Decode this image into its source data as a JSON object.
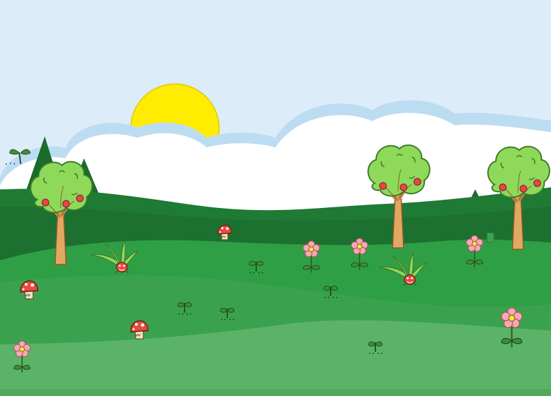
{
  "scene": {
    "type": "side-scrolling game background",
    "colors": {
      "sky": "#dcecf8",
      "cloud": "#ffffff",
      "cloud_outline": "#bcdcf2",
      "sun": "#ffec00",
      "far_hill": "#1f7a33",
      "mid_hill": "#2f9f45",
      "near_ground": "#3aa24e",
      "front_ground": "#5bb368",
      "tree_trunk": "#e0a860",
      "tree_leaves": "#8fd95a",
      "apple": "#e94545",
      "flower_petal": "#f4a9b5",
      "flower_center": "#ffe14a",
      "mushroom_cap": "#e64b3c"
    },
    "sprites": [
      "sun",
      "cloud-bank",
      "pine-tree",
      "apple-tree",
      "mushroom",
      "grass-creature",
      "flower",
      "sprout"
    ]
  }
}
